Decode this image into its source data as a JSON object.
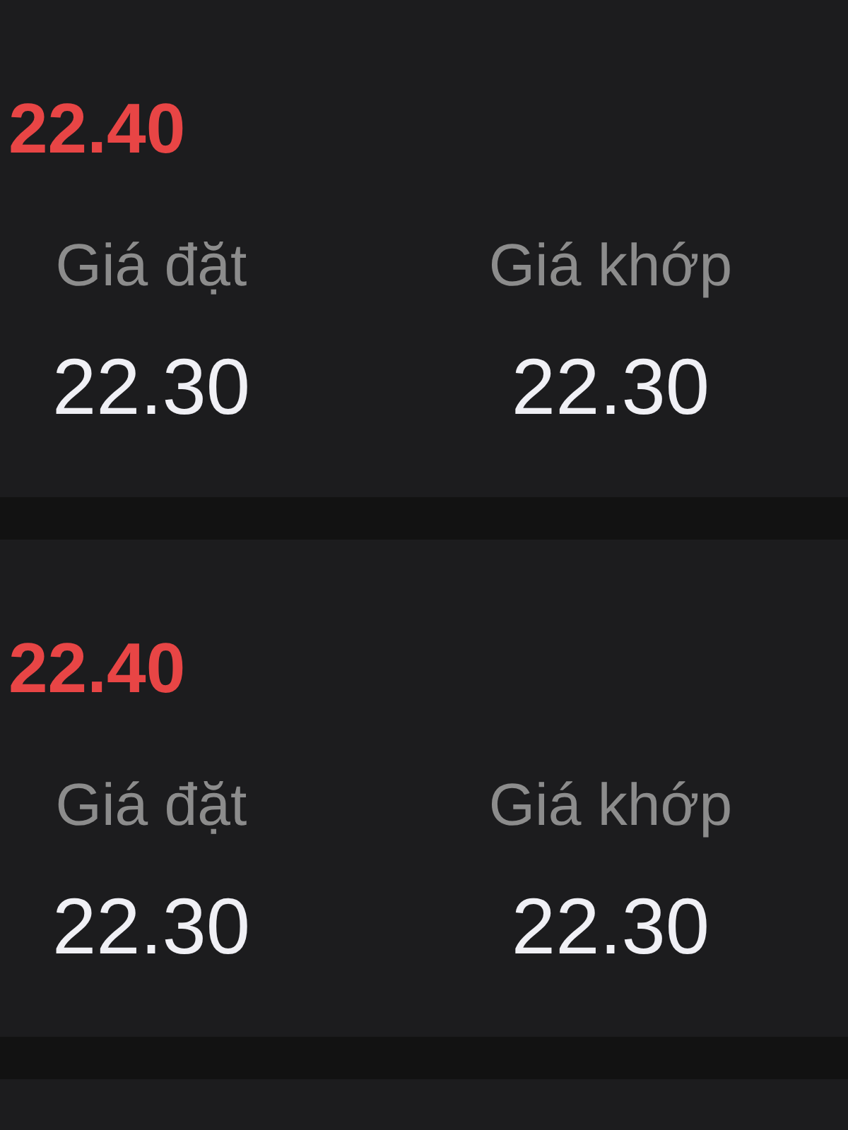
{
  "orders": [
    {
      "price": "22.40",
      "fields": [
        {
          "label": "Giá đặt",
          "value": "22.30"
        },
        {
          "label": "Giá khớp",
          "value": "22.30"
        }
      ]
    },
    {
      "price": "22.40",
      "fields": [
        {
          "label": "Giá đặt",
          "value": "22.30"
        },
        {
          "label": "Giá khớp",
          "value": "22.30"
        }
      ]
    }
  ]
}
